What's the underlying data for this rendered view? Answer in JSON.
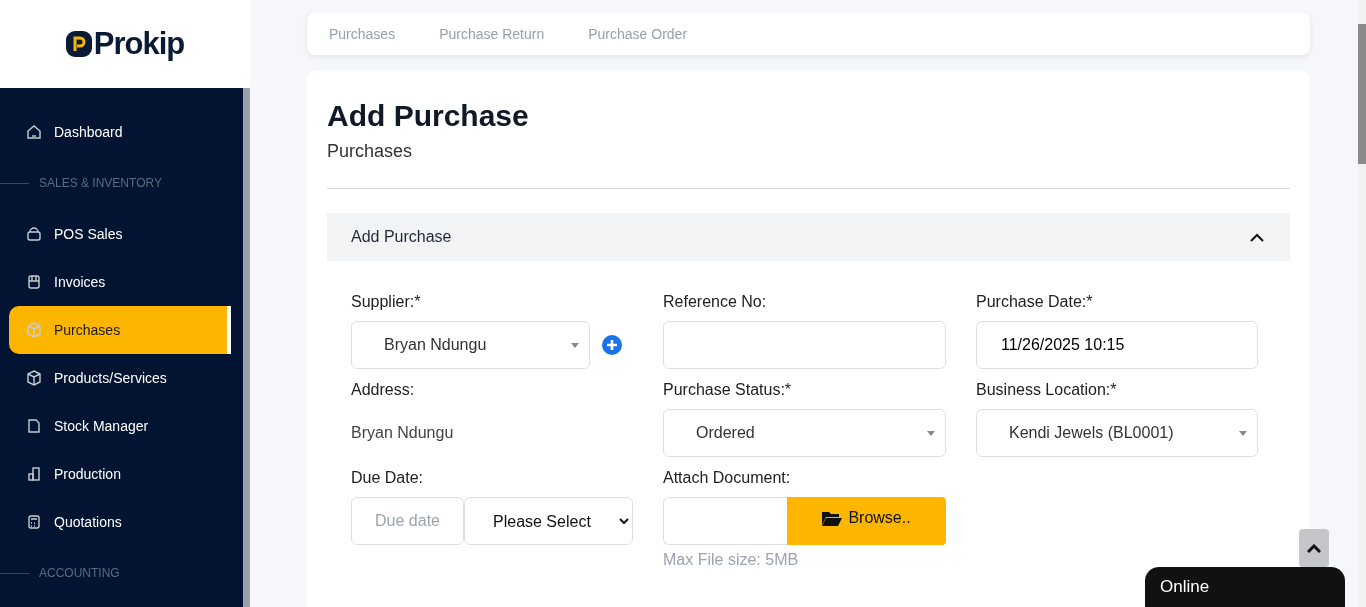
{
  "logo": {
    "text": "Prokip"
  },
  "sidebar": {
    "items": [
      {
        "kind": "item",
        "label": "Dashboard",
        "selected": false
      },
      {
        "kind": "section",
        "label": "SALES & INVENTORY"
      },
      {
        "kind": "item",
        "label": "POS Sales",
        "selected": false
      },
      {
        "kind": "item",
        "label": "Invoices",
        "selected": false
      },
      {
        "kind": "item",
        "label": "Purchases",
        "selected": true
      },
      {
        "kind": "item",
        "label": "Products/Services",
        "selected": false
      },
      {
        "kind": "item",
        "label": "Stock Manager",
        "selected": false
      },
      {
        "kind": "item",
        "label": "Production",
        "selected": false
      },
      {
        "kind": "item",
        "label": "Quotations",
        "selected": false
      },
      {
        "kind": "section",
        "label": "ACCOUNTING"
      }
    ]
  },
  "tabs": [
    {
      "label": "Purchases"
    },
    {
      "label": "Purchase Return"
    },
    {
      "label": "Purchase Order"
    }
  ],
  "page": {
    "title": "Add Purchase",
    "subtitle": "Purchases"
  },
  "panel": {
    "title": "Add Purchase",
    "expanded": true
  },
  "form": {
    "supplier": {
      "label": "Supplier:*",
      "value": "Bryan Ndungu"
    },
    "reference": {
      "label": "Reference No:"
    },
    "purchase_date": {
      "label": "Purchase Date:*",
      "value": "11/26/2025 10:15"
    },
    "address": {
      "label": "Address:",
      "value": "Bryan Ndungu"
    },
    "status": {
      "label": "Purchase Status:*",
      "value": "Ordered"
    },
    "location": {
      "label": "Business Location:*",
      "value": "Kendi Jewels (BL0001)"
    },
    "due_date": {
      "label": "Due Date:",
      "placeholder": "Due date",
      "period": "Please Select"
    },
    "attach": {
      "label": "Attach Document:",
      "button": "Browse..",
      "hint": "Max File size: 5MB"
    }
  },
  "chat": {
    "label": "Online"
  }
}
